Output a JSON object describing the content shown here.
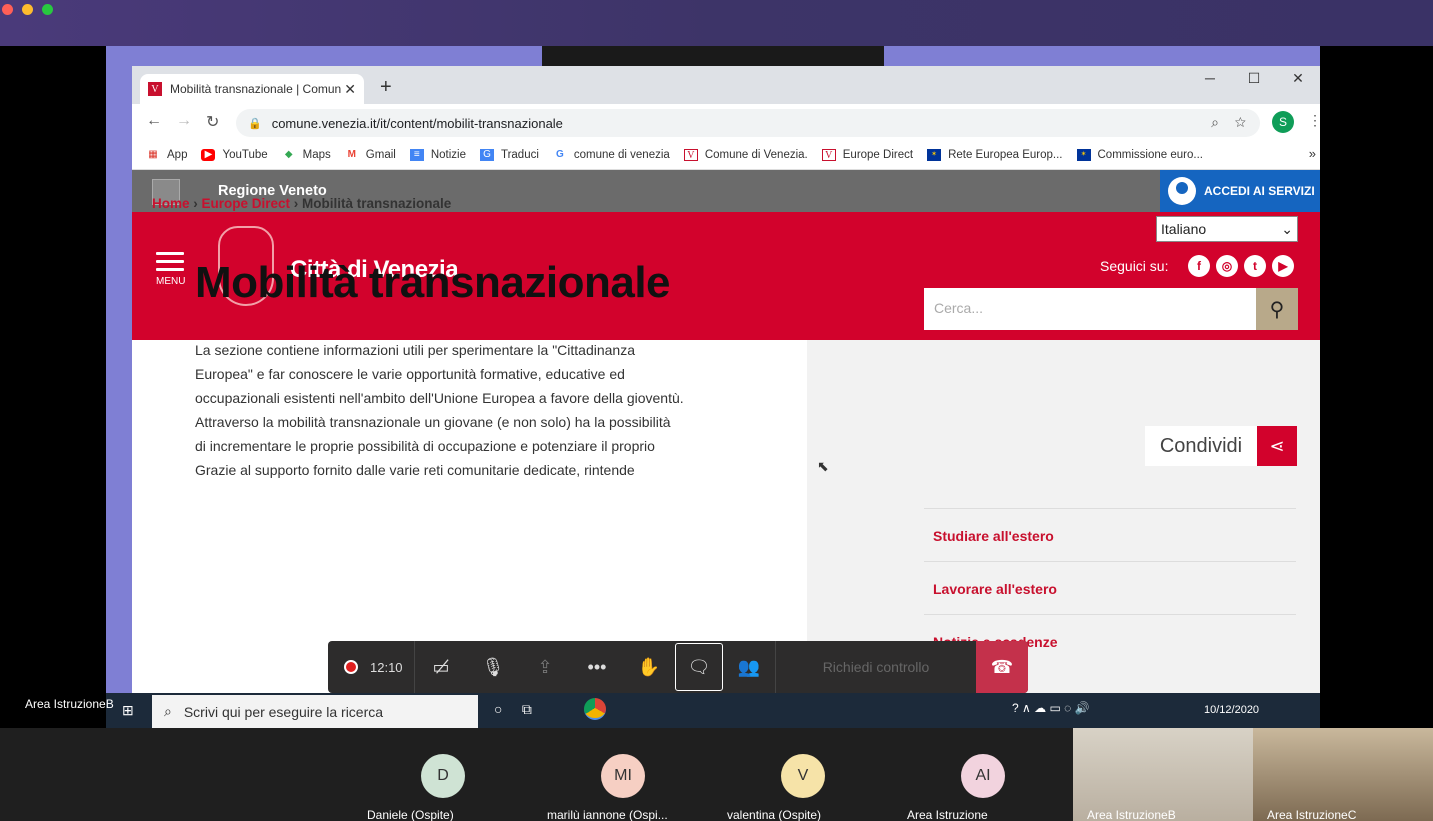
{
  "browser": {
    "tab_title": "Mobilità transnazionale | Comun",
    "tab_favicon": "V",
    "url": "comune.venezia.it/it/content/mobilit-transnazionale",
    "profile_initial": "S"
  },
  "bookmarks": [
    {
      "label": "App",
      "icon": "apps-grid-icon"
    },
    {
      "label": "YouTube",
      "icon": "youtube-icon"
    },
    {
      "label": "Maps",
      "icon": "maps-icon"
    },
    {
      "label": "Gmail",
      "icon": "gmail-icon"
    },
    {
      "label": "Notizie",
      "icon": "news-icon"
    },
    {
      "label": "Traduci",
      "icon": "translate-icon"
    },
    {
      "label": "comune di venezia",
      "icon": "google-icon"
    },
    {
      "label": "Comune di Venezia.",
      "icon": "venezia-icon"
    },
    {
      "label": "Europe Direct",
      "icon": "venezia-icon"
    },
    {
      "label": "Rete Europea Europ...",
      "icon": "eu-flag-icon"
    },
    {
      "label": "Commissione euro...",
      "icon": "eu-flag-icon"
    }
  ],
  "site": {
    "region": "Regione Veneto",
    "accedi": "ACCEDI AI SERVIZI",
    "menu_label": "MENU",
    "city": "Città di Venezia",
    "language": "Italiano",
    "follow": "Seguici su:",
    "search_placeholder": "Cerca...",
    "breadcrumb": {
      "home": "Home",
      "parent": "Europe Direct",
      "current": "Mobilità transnazionale"
    },
    "title": "Mobilità transnazionale",
    "paragraphs": [
      "La sezione contiene informazioni utili per sperimentare la \"Cittadinanza Europea\" e  far conoscere le varie opportunità formative, educative ed occupazionali esistenti nell'ambito dell'Unione Europea a favore della gioventù.",
      "Attraverso la mobilità transnazionale un giovane (e non solo) ha la possibilità di incrementare le proprie possibilità di occupazione e potenziare il proprio",
      "Grazie al supporto fornito dalle varie reti comunitarie dedicate, rintende"
    ],
    "share": "Condividi",
    "side_links": [
      "Studiare all'estero",
      "Lavorare all'estero",
      "Notizie e scadenze"
    ],
    "colors": {
      "brand_red": "#d2022c",
      "region_gray": "#6b6b6b",
      "accedi_blue": "#1565c0"
    }
  },
  "meeting": {
    "timer": "12:10",
    "request_control": "Richiedi controllo"
  },
  "taskbar": {
    "user_label": "Area IstruzioneB",
    "search_placeholder": "Scrivi qui per eseguire la ricerca",
    "date": "10/12/2020"
  },
  "participants": [
    {
      "initials": "D",
      "name": "Daniele (Ospite)",
      "color": "#cfe3d4"
    },
    {
      "initials": "MI",
      "name": "marilù iannone (Ospi...",
      "color": "#f6cfc3"
    },
    {
      "initials": "V",
      "name": "valentina (Ospite)",
      "color": "#f6e3a8"
    },
    {
      "initials": "AI",
      "name": "Area Istruzione",
      "color": "#f2d3de"
    }
  ],
  "videos": [
    {
      "name": "Area IstruzioneB"
    },
    {
      "name": "Area IstruzioneC"
    }
  ]
}
